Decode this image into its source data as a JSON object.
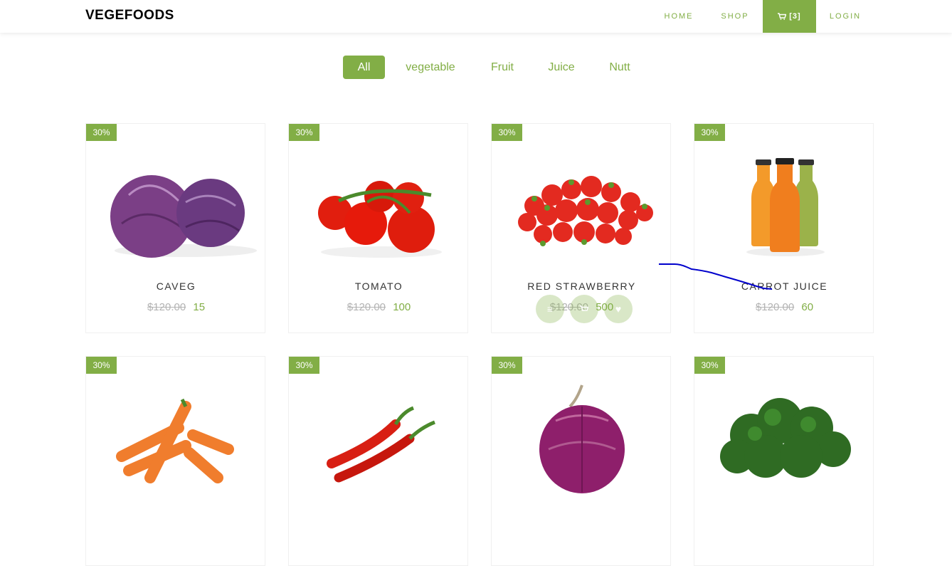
{
  "header": {
    "logo": "VEGEFOODS",
    "nav": {
      "home": "HOME",
      "shop": "SHOP",
      "cart": "[3]",
      "login": "LOGIN"
    }
  },
  "filters": {
    "all": "All",
    "vegetable": "vegetable",
    "fruit": "Fruit",
    "juice": "Juice",
    "nutt": "Nutt"
  },
  "products": [
    {
      "badge": "30%",
      "name": "CAVEG",
      "old_price": "$120.00",
      "price": "15"
    },
    {
      "badge": "30%",
      "name": "TOMATO",
      "old_price": "$120.00",
      "price": "100"
    },
    {
      "badge": "30%",
      "name": "RED STRAWBERRY",
      "old_price": "$120.00",
      "price": "500"
    },
    {
      "badge": "30%",
      "name": "CARROT JUICE",
      "old_price": "$120.00",
      "price": "60"
    },
    {
      "badge": "30%"
    },
    {
      "badge": "30%"
    },
    {
      "badge": "30%"
    },
    {
      "badge": "30%"
    }
  ],
  "colors": {
    "accent": "#82ae46",
    "muted": "#b3b3b3",
    "annotation_stroke": "#0000cc"
  }
}
